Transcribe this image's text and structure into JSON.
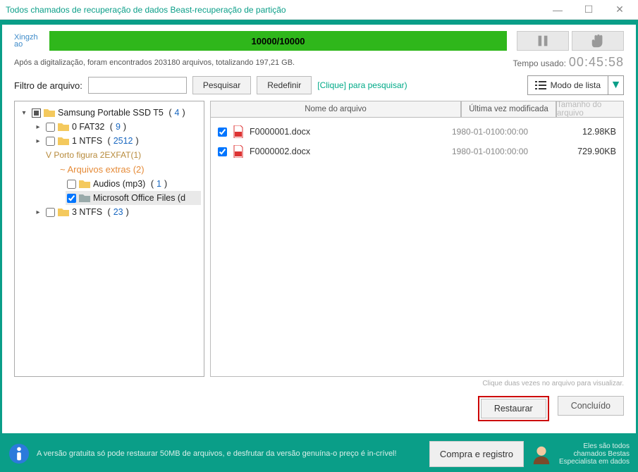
{
  "window": {
    "title": "Todos chamados de recuperação de dados Beast-recuperação de partição"
  },
  "brand": "Xingzh\nao",
  "progress": {
    "text": "10000/10000"
  },
  "status": {
    "line": "Após a digitalização, foram encontrados 203180 arquivos, totalizando 197,21 GB.",
    "time_label": "Tempo usado:",
    "time_value": "00:45:58"
  },
  "filter": {
    "label": "Filtro de arquivo:",
    "value": "",
    "search": "Pesquisar",
    "reset": "Redefinir",
    "hint": "[Clique] para pesquisar)"
  },
  "view_mode": {
    "label": "Modo de lista"
  },
  "tree": {
    "root": {
      "label": "Samsung Portable SSD T5",
      "count": "4"
    },
    "n0": {
      "label": "0 FAT32",
      "count": "9"
    },
    "n1": {
      "label": "1 NTFS",
      "count": "2512"
    },
    "vport": "V Porto figura 2EXFAT(1)",
    "extras": {
      "label": "~ Arquivos extras",
      "count": "2"
    },
    "audios": {
      "label": "Audios (mp3)",
      "count": "1"
    },
    "office": {
      "label": "Microsoft Office Files (d"
    },
    "n3": {
      "label": "3 NTFS",
      "count": "23"
    }
  },
  "columns": {
    "name": "Nome do arquivo",
    "date": "Última vez modificada",
    "size": "Tamanho do arquivo"
  },
  "files": [
    {
      "name": "F0000001.docx",
      "date": "1980-01-0100:00:00",
      "size": "12.98KB"
    },
    {
      "name": "F0000002.docx",
      "date": "1980-01-0100:00:00",
      "size": "729.90KB"
    }
  ],
  "hint": "Clique duas vezes no arquivo para visualizar.",
  "actions": {
    "restore": "Restaurar",
    "done": "Concluído"
  },
  "footer": {
    "text": "A versão gratuita só pode restaurar 50MB de arquivos, e desfrutar da versão genuína-o preço é in-crível!",
    "buy": "Compra e registro",
    "tag1": "Eles são todos",
    "tag2": "chamados Bestas",
    "tag3": "Especialista em dados"
  }
}
